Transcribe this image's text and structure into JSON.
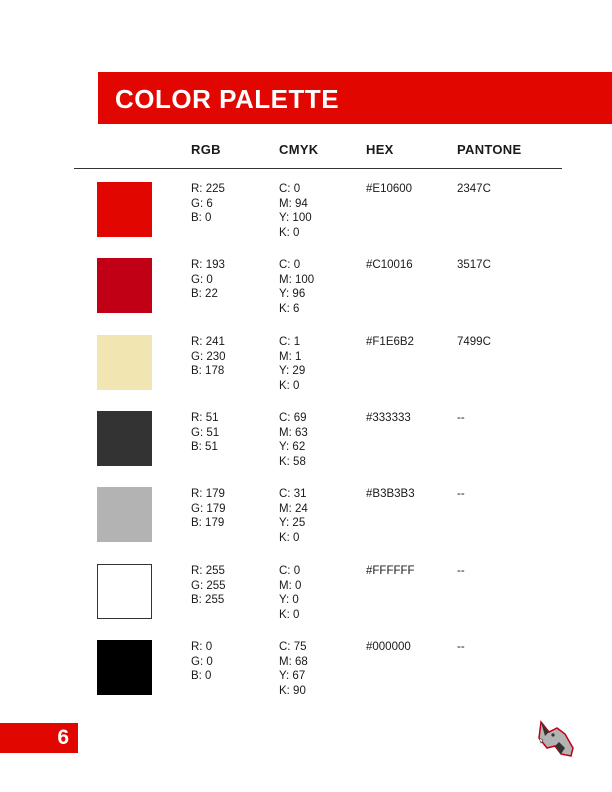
{
  "header": {
    "title": "COLOR PALETTE"
  },
  "columns": {
    "rgb": "RGB",
    "cmyk": "CMYK",
    "hex": "HEX",
    "pantone": "PANTONE"
  },
  "colors": [
    {
      "swatch": "#E10600",
      "rgb": "R: 225\nG: 6\nB: 0",
      "cmyk": "C: 0\nM: 94\nY: 100\nK: 0",
      "hex": "#E10600",
      "pantone": "2347C"
    },
    {
      "swatch": "#C10016",
      "rgb": "R: 193\nG: 0\nB: 22",
      "cmyk": "C: 0\nM: 100\nY: 96\nK: 6",
      "hex": "#C10016",
      "pantone": "3517C"
    },
    {
      "swatch": "#F1E6B2",
      "rgb": "R: 241\nG: 230\nB: 178",
      "cmyk": "C: 1\nM: 1\nY: 29\nK: 0",
      "hex": "#F1E6B2",
      "pantone": "7499C"
    },
    {
      "swatch": "#333333",
      "rgb": "R: 51\nG: 51\nB: 51",
      "cmyk": "C: 69\nM: 63\nY: 62\nK: 58",
      "hex": "#333333",
      "pantone": "--"
    },
    {
      "swatch": "#B3B3B3",
      "rgb": "R: 179\nG: 179\nB: 179",
      "cmyk": "C: 31\nM: 24\nY: 25\nK: 0",
      "hex": "#B3B3B3",
      "pantone": "--"
    },
    {
      "swatch": "#FFFFFF",
      "rgb": "R: 255\nG: 255\nB: 255",
      "cmyk": "C: 0\nM: 0\nY: 0\nK: 0",
      "hex": "#FFFFFF",
      "pantone": "--"
    },
    {
      "swatch": "#000000",
      "rgb": "R: 0\nG: 0\nB: 0",
      "cmyk": "C: 75\nM: 68\nY: 67\nK: 90",
      "hex": "#000000",
      "pantone": "--"
    }
  ],
  "footer": {
    "page_number": "6",
    "logo_icon": "wolf-head-icon"
  },
  "theme": {
    "accent": "#E10600"
  }
}
